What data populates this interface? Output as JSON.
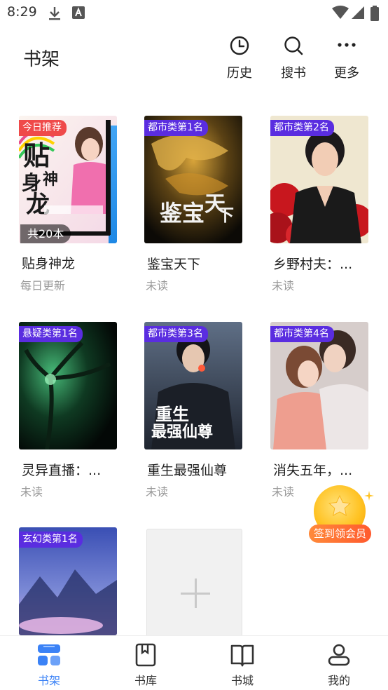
{
  "status_bar": {
    "time": "8:29"
  },
  "header": {
    "title": "书架",
    "actions": [
      {
        "label": "历史",
        "icon": "clock-icon"
      },
      {
        "label": "搜书",
        "icon": "search-icon"
      },
      {
        "label": "更多",
        "icon": "more-icon"
      }
    ]
  },
  "books": [
    {
      "title": "贴身神龙",
      "subtitle": "每日更新",
      "badge": "今日推荐",
      "count": "共20本",
      "cover_text": "贴身神龙"
    },
    {
      "title": "鉴宝天下",
      "subtitle": "未读",
      "badge": "都市类第1名",
      "cover_text": "鉴宝天下"
    },
    {
      "title": "乡野村夫：...",
      "subtitle": "未读",
      "badge": "都市类第2名"
    },
    {
      "title": "灵异直播：...",
      "subtitle": "未读",
      "badge": "悬疑类第1名"
    },
    {
      "title": "重生最强仙尊",
      "subtitle": "未读",
      "badge": "都市类第3名",
      "cover_text": "重生最强仙尊"
    },
    {
      "title": "消失五年，...",
      "subtitle": "未读",
      "badge": "都市类第4名"
    },
    {
      "badge": "玄幻类第1名"
    }
  ],
  "signin": {
    "label": "签到领会员"
  },
  "bottom_nav": [
    {
      "label": "书架",
      "icon": "bookshelf-icon",
      "active": true
    },
    {
      "label": "书库",
      "icon": "library-icon"
    },
    {
      "label": "书城",
      "icon": "bookstore-icon"
    },
    {
      "label": "我的",
      "icon": "profile-icon"
    }
  ],
  "colors": {
    "accent": "#3b82f6",
    "badge_purple": "#5a2de0",
    "badge_red": "#ef4a4a",
    "signin_orange": "#ff6a33"
  }
}
